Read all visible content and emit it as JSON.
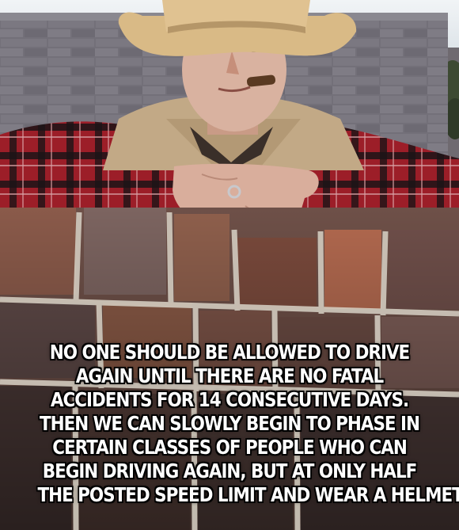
{
  "meme": {
    "caption_lines": [
      "NO ONE SHOULD BE ALLOWED TO DRIVE",
      "AGAIN UNTIL THERE ARE NO FATAL",
      "ACCIDENTS FOR 14 CONSECUTIVE DAYS.",
      "THEN WE CAN SLOWLY BEGIN TO PHASE IN",
      "CERTAIN CLASSES OF PEOPLE WHO CAN",
      "BEGIN DRIVING AGAIN, BUT AT ONLY HALF",
      "THE POSTED SPEED LIMIT AND WEAR A HELMET."
    ],
    "caption_color": "#ffffff",
    "caption_outline_color": "#000000"
  },
  "photo": {
    "sky_color": "#e6ecf1",
    "wall_color": "#737079",
    "brick_color": "#7c4a3a",
    "hat_color": "#e0c291",
    "shirt_red": "#9c1e28",
    "shirt_black": "#1c1416",
    "vest_color": "#c2a986",
    "skin_color": "#d9b2a0"
  }
}
